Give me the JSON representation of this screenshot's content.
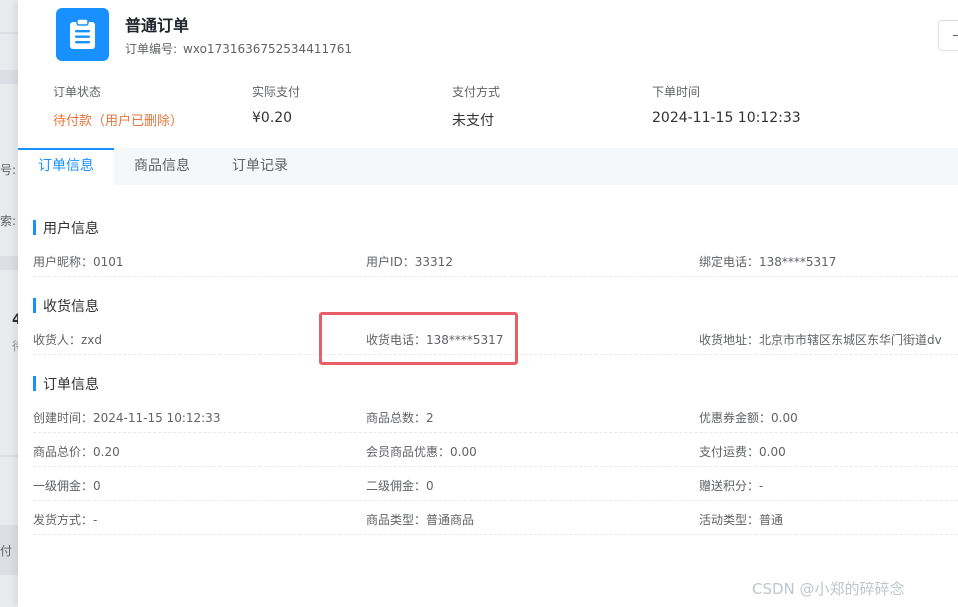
{
  "background": {
    "labels": [
      "号:",
      "索:",
      "4",
      "待",
      "付"
    ]
  },
  "header": {
    "title": "普通订单",
    "order_no_label": "订单编号:",
    "order_no": "wxo1731636752534411761"
  },
  "summary": [
    {
      "label": "订单状态",
      "value": "待付款（用户已删除）"
    },
    {
      "label": "实际支付",
      "value": "¥0.20"
    },
    {
      "label": "支付方式",
      "value": "未支付"
    },
    {
      "label": "下单时间",
      "value": "2024-11-15 10:12:33"
    }
  ],
  "tabs": [
    "订单信息",
    "商品信息",
    "订单记录"
  ],
  "sections": {
    "user": {
      "title": "用户信息",
      "fields": [
        "用户昵称：0101",
        "用户ID：33312",
        "绑定电话：138****5317"
      ]
    },
    "shipping": {
      "title": "收货信息",
      "fields": [
        "收货人：zxd",
        "收货电话：138****5317",
        "收货地址：北京市市辖区东城区东华门街道dv"
      ]
    },
    "order": {
      "title": "订单信息",
      "rows": [
        [
          "创建时间：2024-11-15 10:12:33",
          "商品总数：2",
          "优惠券金额：0.00"
        ],
        [
          "商品总价：0.20",
          "会员商品优惠：0.00",
          "支付运费：0.00"
        ],
        [
          "一级佣金：0",
          "二级佣金：0",
          "赠送积分：-"
        ],
        [
          "发货方式：-",
          "商品类型：普通商品",
          "活动类型：普通"
        ]
      ]
    }
  },
  "watermark": "CSDN @小郑的碎碎念",
  "colors": {
    "accent": "#1890ff",
    "warning": "#e6753a",
    "highlight": "#e95f67"
  }
}
